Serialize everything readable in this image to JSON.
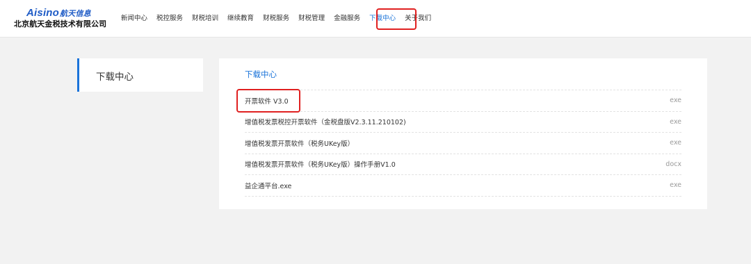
{
  "header": {
    "brand": "Aisino",
    "brand_cn": "航天信息",
    "company": "北京航天金税技术有限公司",
    "nav": [
      {
        "label": "新闻中心"
      },
      {
        "label": "税控服务"
      },
      {
        "label": "财税培训"
      },
      {
        "label": "继续教育"
      },
      {
        "label": "财税服务"
      },
      {
        "label": "财税管理"
      },
      {
        "label": "金融服务"
      },
      {
        "label": "下载中心",
        "active": true
      },
      {
        "label": "关于我们"
      }
    ]
  },
  "sidebar": {
    "title": "下载中心"
  },
  "main": {
    "title": "下载中心",
    "downloads": [
      {
        "name": "开票软件 V3.0",
        "ext": "exe"
      },
      {
        "name": "增值税发票税控开票软件（金税盘版V2.3.11.210102)",
        "ext": "exe"
      },
      {
        "name": "增值税发票开票软件（税务UKey版）",
        "ext": "exe"
      },
      {
        "name": "增值税发票开票软件（税务UKey版）操作手册V1.0",
        "ext": "docx"
      },
      {
        "name": "益企通平台.exe",
        "ext": "exe"
      }
    ]
  },
  "colors": {
    "accent": "#1a73d9",
    "highlight": "#e02020",
    "background": "#f2f2f2"
  }
}
